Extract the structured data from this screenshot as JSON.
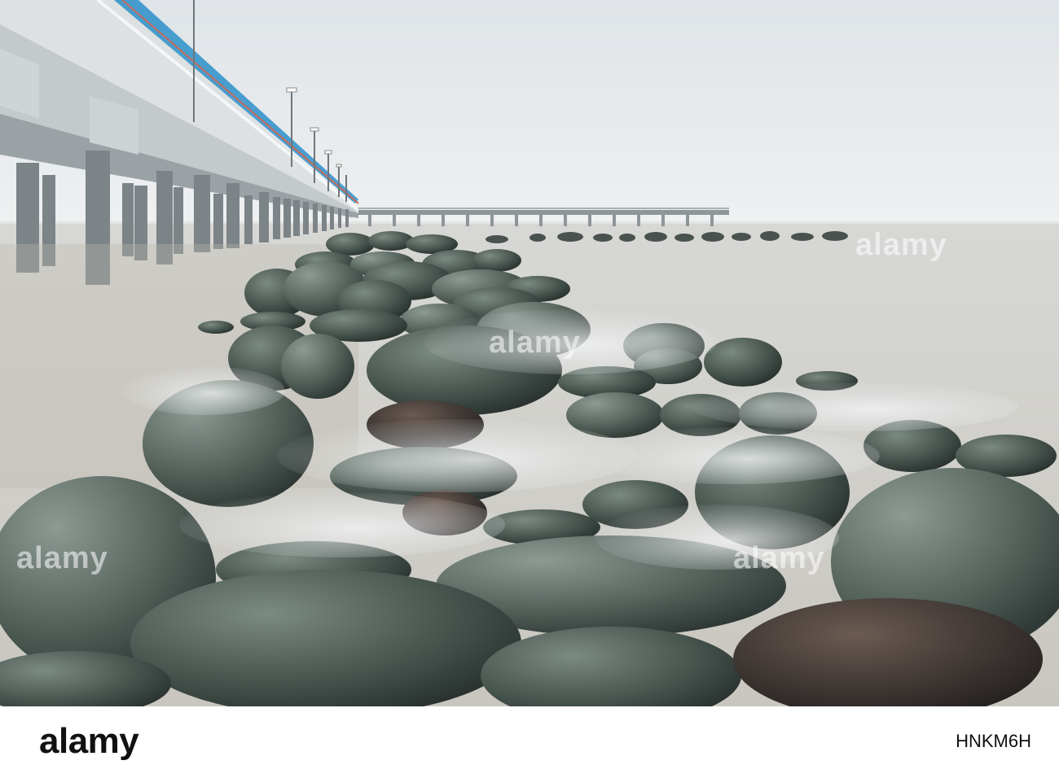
{
  "photo": {
    "subject": "stone-breakwater-pier",
    "palette": {
      "sky": "#e8ecef",
      "sea": "#cfcfcb",
      "mist": "#e9eced",
      "rock_dark": "#2f3b37",
      "rock_mid": "#5d6b62",
      "pier": "#d8dcdd",
      "railing_blue": "#2b8fc9"
    }
  },
  "watermark": {
    "text": "alamy"
  },
  "footer": {
    "logo_text": "alamy",
    "image_id": "HNKM6H"
  }
}
